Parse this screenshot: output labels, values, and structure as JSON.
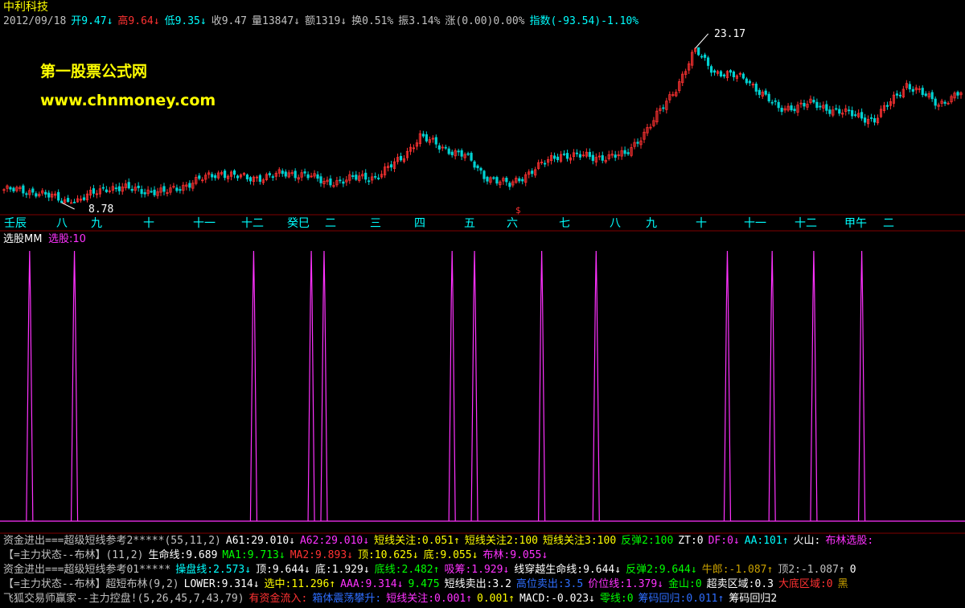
{
  "stock_name": "中利科技",
  "watermark": {
    "line1": "第一股票公式网",
    "line2": "www.chnmoney.com"
  },
  "colors": {
    "up": "#ff3232",
    "down": "#00d2d2",
    "magenta": "#ff32ff",
    "cyan": "#00ffff",
    "yellow": "#ffff00",
    "white": "#ffffff",
    "green": "#00ff00",
    "gridline": "#800000",
    "blue": "#2e6eff",
    "olive": "#c8a000"
  },
  "quote_bar": [
    {
      "text": "2012/09/18",
      "color": "#c0c0c0"
    },
    {
      "text": "开9.47↓",
      "color": "#00ffff"
    },
    {
      "text": "高9.64↓",
      "color": "#ff3232"
    },
    {
      "text": "低9.35↓",
      "color": "#00ffff"
    },
    {
      "text": "收9.47",
      "color": "#c0c0c0"
    },
    {
      "text": "量13847↓",
      "color": "#c0c0c0"
    },
    {
      "text": "额1319↓",
      "color": "#c0c0c0"
    },
    {
      "text": "换0.51%",
      "color": "#c0c0c0"
    },
    {
      "text": "振3.14%",
      "color": "#c0c0c0"
    },
    {
      "text": "涨(0.00)0.00%",
      "color": "#c0c0c0"
    },
    {
      "text": "指数(-93.54)-1.10%",
      "color": "#00ffff"
    }
  ],
  "price_labels": {
    "high": "23.17",
    "low": "8.78",
    "signal_mark": "$"
  },
  "axis_months": [
    "壬辰",
    "八",
    "九",
    "十",
    "十一",
    "十二",
    "癸巳",
    "二",
    "三",
    "四",
    "五",
    "六",
    "七",
    "八",
    "九",
    "十",
    "十一",
    "十二",
    "甲午",
    "二"
  ],
  "panel_title": "选股MM",
  "panel_value": "选股:10",
  "chart_data": {
    "type": "line",
    "price_range": [
      8.78,
      23.17
    ],
    "close_anchors": [
      {
        "bar": 0,
        "close": 10.0
      },
      {
        "bar": 10,
        "close": 9.8
      },
      {
        "bar": 18,
        "close": 9.0
      },
      {
        "bar": 22,
        "close": 8.8
      },
      {
        "bar": 32,
        "close": 10.2
      },
      {
        "bar": 42,
        "close": 10.0
      },
      {
        "bar": 50,
        "close": 9.7
      },
      {
        "bar": 60,
        "close": 10.8
      },
      {
        "bar": 68,
        "close": 11.6
      },
      {
        "bar": 76,
        "close": 11.0
      },
      {
        "bar": 86,
        "close": 11.4
      },
      {
        "bar": 94,
        "close": 11.5
      },
      {
        "bar": 100,
        "close": 10.6
      },
      {
        "bar": 108,
        "close": 11.0
      },
      {
        "bar": 116,
        "close": 11.2
      },
      {
        "bar": 124,
        "close": 12.8
      },
      {
        "bar": 130,
        "close": 15.0
      },
      {
        "bar": 136,
        "close": 14.0
      },
      {
        "bar": 144,
        "close": 13.2
      },
      {
        "bar": 150,
        "close": 11.3
      },
      {
        "bar": 158,
        "close": 10.4
      },
      {
        "bar": 166,
        "close": 12.0
      },
      {
        "bar": 174,
        "close": 13.3
      },
      {
        "bar": 184,
        "close": 13.0
      },
      {
        "bar": 194,
        "close": 13.2
      },
      {
        "bar": 202,
        "close": 16.0
      },
      {
        "bar": 210,
        "close": 19.5
      },
      {
        "bar": 216,
        "close": 23.0
      },
      {
        "bar": 222,
        "close": 21.0
      },
      {
        "bar": 232,
        "close": 20.3
      },
      {
        "bar": 242,
        "close": 17.5
      },
      {
        "bar": 252,
        "close": 18.0
      },
      {
        "bar": 262,
        "close": 17.2
      },
      {
        "bar": 272,
        "close": 16.5
      },
      {
        "bar": 282,
        "close": 19.8
      },
      {
        "bar": 292,
        "close": 18.0
      },
      {
        "bar": 299,
        "close": 19.0
      }
    ],
    "selection_signals": [
      8,
      22,
      78,
      96,
      100,
      140,
      147,
      168,
      185,
      226,
      240,
      253,
      268
    ],
    "bar_count": 300
  },
  "indicator_rows": [
    [
      {
        "text": "资金进出===超级短线参考2*****(55,11,2)",
        "color": "#c0c0c0"
      },
      {
        "text": "A61:29.010↓",
        "color": "#ffffff"
      },
      {
        "text": "A62:29.010↓",
        "color": "#ff32ff"
      },
      {
        "text": "短线关注:0.051↑",
        "color": "#ffff00"
      },
      {
        "text": "短线关注2:100",
        "color": "#ffff00"
      },
      {
        "text": "短线关注3:100",
        "color": "#ffff00"
      },
      {
        "text": "反弹2:100",
        "color": "#00ff00"
      },
      {
        "text": "ZT:0",
        "color": "#ffffff"
      },
      {
        "text": "DF:0↓",
        "color": "#ff32ff"
      },
      {
        "text": "AA:101↑",
        "color": "#00ffff"
      },
      {
        "text": "火山:",
        "color": "#ffffff"
      },
      {
        "text": "布林选股:",
        "color": "#ff32ff"
      }
    ],
    [
      {
        "text": "【=主力状态--布林】(11,2)",
        "color": "#c0c0c0"
      },
      {
        "text": "生命线:9.689",
        "color": "#ffffff"
      },
      {
        "text": "MA1:9.713↓",
        "color": "#00ff00"
      },
      {
        "text": "MA2:9.893↓",
        "color": "#ff3232"
      },
      {
        "text": "顶:10.625↓",
        "color": "#ffff00"
      },
      {
        "text": "底:9.055↓",
        "color": "#ffff00"
      },
      {
        "text": "布林:9.055↓",
        "color": "#ff32ff"
      }
    ],
    [
      {
        "text": "资金进出===超级短线参考01*****",
        "color": "#c0c0c0"
      },
      {
        "text": "操盘线:2.573↓",
        "color": "#00ffff"
      },
      {
        "text": "顶:9.644↓",
        "color": "#ffffff"
      },
      {
        "text": "底:1.929↓",
        "color": "#ffffff"
      },
      {
        "text": "底线:2.482↑",
        "color": "#00ff00"
      },
      {
        "text": "吸筹:1.929↓",
        "color": "#ff32ff"
      },
      {
        "text": "线穿越生命线:9.644↓",
        "color": "#ffffff"
      },
      {
        "text": "反弹2:9.644↓",
        "color": "#00ff00"
      },
      {
        "text": "牛郎:-1.087↑",
        "color": "#c8a000"
      },
      {
        "text": "顶2:-1.087↑",
        "color": "#c0c0c0"
      },
      {
        "text": "0",
        "color": "#ffffff"
      }
    ],
    [
      {
        "text": "【=主力状态--布林】超短布林(9,2)",
        "color": "#c0c0c0"
      },
      {
        "text": "LOWER:9.314↓",
        "color": "#ffffff"
      },
      {
        "text": "选中:11.296↑",
        "color": "#ffff00"
      },
      {
        "text": "AAA:9.314↓",
        "color": "#ff32ff"
      },
      {
        "text": "9.475",
        "color": "#00ff00"
      },
      {
        "text": "短线卖出:3.2",
        "color": "#ffffff"
      },
      {
        "text": "高位卖出:3.5",
        "color": "#2e6eff"
      },
      {
        "text": "价位线:1.379↓",
        "color": "#ff32ff"
      },
      {
        "text": "金山:0",
        "color": "#00ff00"
      },
      {
        "text": "超卖区域:0.3",
        "color": "#ffffff"
      },
      {
        "text": "大底区域:0",
        "color": "#ff3232"
      },
      {
        "text": "黑",
        "color": "#c8a000"
      }
    ],
    [
      {
        "text": "飞狐交易师赢家--主力控盘!(5,26,45,7,43,79)",
        "color": "#c0c0c0"
      },
      {
        "text": "有资金流入:",
        "color": "#ff3232"
      },
      {
        "text": "箱体震荡攀升:",
        "color": "#2e6eff"
      },
      {
        "text": "短线关注:0.001↑",
        "color": "#ff32ff"
      },
      {
        "text": "0.001↑",
        "color": "#ffff00"
      },
      {
        "text": "MACD:-0.023↓",
        "color": "#ffffff"
      },
      {
        "text": "零线:0",
        "color": "#00ff00"
      },
      {
        "text": "筹码回归:0.011↑",
        "color": "#2e6eff"
      },
      {
        "text": "筹码回归2",
        "color": "#ffffff"
      }
    ]
  ]
}
